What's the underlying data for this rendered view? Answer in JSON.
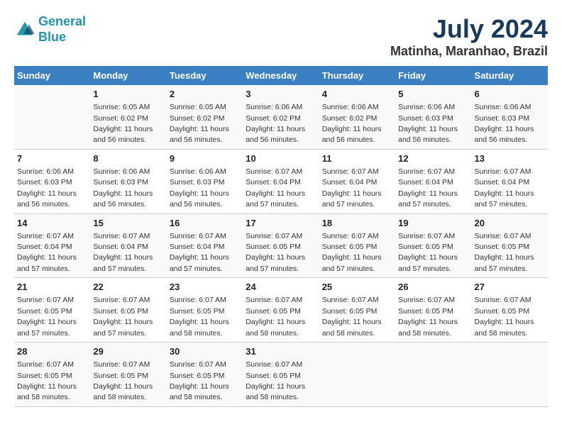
{
  "header": {
    "logo_line1": "General",
    "logo_line2": "Blue",
    "title": "July 2024",
    "subtitle": "Matinha, Maranhao, Brazil"
  },
  "days_of_week": [
    "Sunday",
    "Monday",
    "Tuesday",
    "Wednesday",
    "Thursday",
    "Friday",
    "Saturday"
  ],
  "weeks": [
    [
      null,
      {
        "day": "1",
        "sunrise": "6:05 AM",
        "sunset": "6:02 PM",
        "daylight": "11 hours and 56 minutes."
      },
      {
        "day": "2",
        "sunrise": "6:05 AM",
        "sunset": "6:02 PM",
        "daylight": "11 hours and 56 minutes."
      },
      {
        "day": "3",
        "sunrise": "6:06 AM",
        "sunset": "6:02 PM",
        "daylight": "11 hours and 56 minutes."
      },
      {
        "day": "4",
        "sunrise": "6:06 AM",
        "sunset": "6:02 PM",
        "daylight": "11 hours and 56 minutes."
      },
      {
        "day": "5",
        "sunrise": "6:06 AM",
        "sunset": "6:03 PM",
        "daylight": "11 hours and 56 minutes."
      },
      {
        "day": "6",
        "sunrise": "6:06 AM",
        "sunset": "6:03 PM",
        "daylight": "11 hours and 56 minutes."
      }
    ],
    [
      {
        "day": "7",
        "sunrise": "6:06 AM",
        "sunset": "6:03 PM",
        "daylight": "11 hours and 56 minutes."
      },
      {
        "day": "8",
        "sunrise": "6:06 AM",
        "sunset": "6:03 PM",
        "daylight": "11 hours and 56 minutes."
      },
      {
        "day": "9",
        "sunrise": "6:06 AM",
        "sunset": "6:03 PM",
        "daylight": "11 hours and 56 minutes."
      },
      {
        "day": "10",
        "sunrise": "6:07 AM",
        "sunset": "6:04 PM",
        "daylight": "11 hours and 57 minutes."
      },
      {
        "day": "11",
        "sunrise": "6:07 AM",
        "sunset": "6:04 PM",
        "daylight": "11 hours and 57 minutes."
      },
      {
        "day": "12",
        "sunrise": "6:07 AM",
        "sunset": "6:04 PM",
        "daylight": "11 hours and 57 minutes."
      },
      {
        "day": "13",
        "sunrise": "6:07 AM",
        "sunset": "6:04 PM",
        "daylight": "11 hours and 57 minutes."
      }
    ],
    [
      {
        "day": "14",
        "sunrise": "6:07 AM",
        "sunset": "6:04 PM",
        "daylight": "11 hours and 57 minutes."
      },
      {
        "day": "15",
        "sunrise": "6:07 AM",
        "sunset": "6:04 PM",
        "daylight": "11 hours and 57 minutes."
      },
      {
        "day": "16",
        "sunrise": "6:07 AM",
        "sunset": "6:04 PM",
        "daylight": "11 hours and 57 minutes."
      },
      {
        "day": "17",
        "sunrise": "6:07 AM",
        "sunset": "6:05 PM",
        "daylight": "11 hours and 57 minutes."
      },
      {
        "day": "18",
        "sunrise": "6:07 AM",
        "sunset": "6:05 PM",
        "daylight": "11 hours and 57 minutes."
      },
      {
        "day": "19",
        "sunrise": "6:07 AM",
        "sunset": "6:05 PM",
        "daylight": "11 hours and 57 minutes."
      },
      {
        "day": "20",
        "sunrise": "6:07 AM",
        "sunset": "6:05 PM",
        "daylight": "11 hours and 57 minutes."
      }
    ],
    [
      {
        "day": "21",
        "sunrise": "6:07 AM",
        "sunset": "6:05 PM",
        "daylight": "11 hours and 57 minutes."
      },
      {
        "day": "22",
        "sunrise": "6:07 AM",
        "sunset": "6:05 PM",
        "daylight": "11 hours and 57 minutes."
      },
      {
        "day": "23",
        "sunrise": "6:07 AM",
        "sunset": "6:05 PM",
        "daylight": "11 hours and 58 minutes."
      },
      {
        "day": "24",
        "sunrise": "6:07 AM",
        "sunset": "6:05 PM",
        "daylight": "11 hours and 58 minutes."
      },
      {
        "day": "25",
        "sunrise": "6:07 AM",
        "sunset": "6:05 PM",
        "daylight": "11 hours and 58 minutes."
      },
      {
        "day": "26",
        "sunrise": "6:07 AM",
        "sunset": "6:05 PM",
        "daylight": "11 hours and 58 minutes."
      },
      {
        "day": "27",
        "sunrise": "6:07 AM",
        "sunset": "6:05 PM",
        "daylight": "11 hours and 58 minutes."
      }
    ],
    [
      {
        "day": "28",
        "sunrise": "6:07 AM",
        "sunset": "6:05 PM",
        "daylight": "11 hours and 58 minutes."
      },
      {
        "day": "29",
        "sunrise": "6:07 AM",
        "sunset": "6:05 PM",
        "daylight": "11 hours and 58 minutes."
      },
      {
        "day": "30",
        "sunrise": "6:07 AM",
        "sunset": "6:05 PM",
        "daylight": "11 hours and 58 minutes."
      },
      {
        "day": "31",
        "sunrise": "6:07 AM",
        "sunset": "6:05 PM",
        "daylight": "11 hours and 58 minutes."
      },
      null,
      null,
      null
    ]
  ]
}
